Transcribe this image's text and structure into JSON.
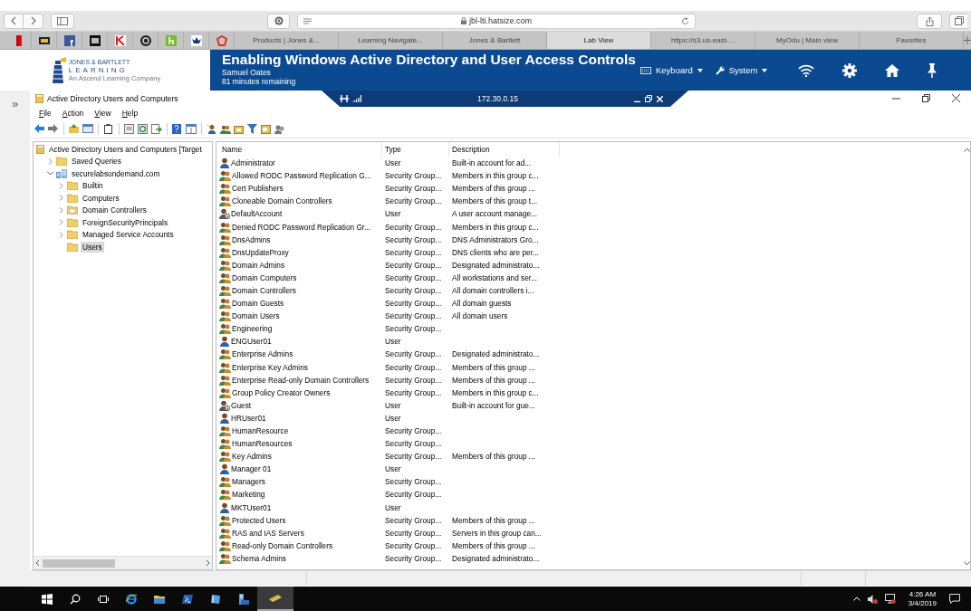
{
  "browser": {
    "url": "jbl-lti.hatsize.com",
    "tabs": [
      {
        "label": "Products | Jones &...",
        "selected": false
      },
      {
        "label": "Learning Navigate...",
        "selected": false
      },
      {
        "label": "Jones & Bartlett",
        "selected": false
      },
      {
        "label": "Lab View",
        "selected": true
      },
      {
        "label": "https://s3.us-east-...",
        "selected": false
      },
      {
        "label": "MyOdu | Main view",
        "selected": false
      },
      {
        "label": "Favorites",
        "selected": false
      }
    ]
  },
  "lab": {
    "logo_line_1": "JONES & BARTLETT",
    "logo_line_2": "LEARNING",
    "logo_tagline": "An Ascend Learning Company",
    "title": "Enabling Windows Active Directory and User Access Controls",
    "user": "Samuel Oates",
    "time_remaining": "81 minutes remaining",
    "menus": [
      {
        "kind": "keyboard",
        "label": "Keyboard"
      },
      {
        "kind": "system",
        "label": "System"
      }
    ]
  },
  "sidebar_toggle": "»",
  "remote": {
    "address": "172.30.0.15"
  },
  "window": {
    "title": "Active Directory Users and Computers",
    "menu": [
      "File",
      "Action",
      "View",
      "Help"
    ],
    "tree": [
      {
        "kind": "snapin",
        "label": "Active Directory Users and Computers [Target",
        "selected": false,
        "children": [
          {
            "kind": "folder",
            "label": "Saved Queries",
            "selected": false,
            "expanded": false
          },
          {
            "kind": "domain",
            "label": "securelabsondemand.com",
            "selected": false,
            "expanded": true,
            "children": [
              {
                "kind": "folder",
                "label": "Builtin",
                "selected": false,
                "expanded": false
              },
              {
                "kind": "folder",
                "label": "Computers",
                "selected": false,
                "expanded": false
              },
              {
                "kind": "ou",
                "label": "Domain Controllers",
                "selected": false,
                "expanded": false
              },
              {
                "kind": "folder",
                "label": "ForeignSecurityPrincipals",
                "selected": false,
                "expanded": false
              },
              {
                "kind": "folder",
                "label": "Managed Service Accounts",
                "selected": false,
                "expanded": false
              },
              {
                "kind": "folder",
                "label": "Users",
                "selected": true
              }
            ]
          }
        ]
      }
    ],
    "table": {
      "columns": [
        "Name",
        "Type",
        "Description"
      ],
      "rows": [
        {
          "kind": "user",
          "name": "Administrator",
          "type": "User",
          "description": "Built-in account for ad..."
        },
        {
          "kind": "group",
          "name": "Allowed RODC Password Replication G...",
          "type": "Security Group...",
          "description": "Members in this group c..."
        },
        {
          "kind": "group",
          "name": "Cert Publishers",
          "type": "Security Group...",
          "description": "Members of this group ..."
        },
        {
          "kind": "group",
          "name": "Cloneable Domain Controllers",
          "type": "Security Group...",
          "description": "Members of this group t..."
        },
        {
          "kind": "disabled_user",
          "name": "DefaultAccount",
          "type": "User",
          "description": "A user account manage..."
        },
        {
          "kind": "group",
          "name": "Denied RODC Password Replication Gr...",
          "type": "Security Group...",
          "description": "Members in this group c..."
        },
        {
          "kind": "group",
          "name": "DnsAdmins",
          "type": "Security Group...",
          "description": "DNS Administrators Gro..."
        },
        {
          "kind": "group",
          "name": "DnsUpdateProxy",
          "type": "Security Group...",
          "description": "DNS clients who are per..."
        },
        {
          "kind": "group",
          "name": "Domain Admins",
          "type": "Security Group...",
          "description": "Designated administrato..."
        },
        {
          "kind": "group",
          "name": "Domain Computers",
          "type": "Security Group...",
          "description": "All workstations and ser..."
        },
        {
          "kind": "group",
          "name": "Domain Controllers",
          "type": "Security Group...",
          "description": "All domain controllers i..."
        },
        {
          "kind": "group",
          "name": "Domain Guests",
          "type": "Security Group...",
          "description": "All domain guests"
        },
        {
          "kind": "group",
          "name": "Domain Users",
          "type": "Security Group...",
          "description": "All domain users"
        },
        {
          "kind": "group",
          "name": "Engineering",
          "type": "Security Group..."
        },
        {
          "kind": "user",
          "name": "ENGUser01",
          "type": "User"
        },
        {
          "kind": "group",
          "name": "Enterprise Admins",
          "type": "Security Group...",
          "description": "Designated administrato..."
        },
        {
          "kind": "group",
          "name": "Enterprise Key Admins",
          "type": "Security Group...",
          "description": "Members of this group ..."
        },
        {
          "kind": "group",
          "name": "Enterprise Read-only Domain Controllers",
          "type": "Security Group...",
          "description": "Members of this group ..."
        },
        {
          "kind": "group",
          "name": "Group Policy Creator Owners",
          "type": "Security Group...",
          "description": "Members in this group c..."
        },
        {
          "kind": "disabled_user",
          "name": "Guest",
          "type": "User",
          "description": "Built-in account for gue..."
        },
        {
          "kind": "user",
          "name": "HRUser01",
          "type": "User"
        },
        {
          "kind": "group",
          "name": "HumanResource",
          "type": "Security Group..."
        },
        {
          "kind": "group",
          "name": "HumanResources",
          "type": "Security Group..."
        },
        {
          "kind": "group",
          "name": "Key Admins",
          "type": "Security Group...",
          "description": "Members of this group ..."
        },
        {
          "kind": "user",
          "name": "Manager 01",
          "type": "User"
        },
        {
          "kind": "group",
          "name": "Managers",
          "type": "Security Group..."
        },
        {
          "kind": "group",
          "name": "Marketing",
          "type": "Security Group..."
        },
        {
          "kind": "user",
          "name": "MKTUser01",
          "type": "User"
        },
        {
          "kind": "group",
          "name": "Protected Users",
          "type": "Security Group...",
          "description": "Members of this group ..."
        },
        {
          "kind": "group",
          "name": "RAS and IAS Servers",
          "type": "Security Group...",
          "description": "Servers in this group can..."
        },
        {
          "kind": "group",
          "name": "Read-only Domain Controllers",
          "type": "Security Group...",
          "description": "Members of this group ..."
        },
        {
          "kind": "group",
          "name": "Schema Admins",
          "type": "Security Group...",
          "description": "Designated administrato..."
        }
      ]
    }
  },
  "taskbar": {
    "time": "4:26 AM",
    "date": "3/4/2019"
  }
}
